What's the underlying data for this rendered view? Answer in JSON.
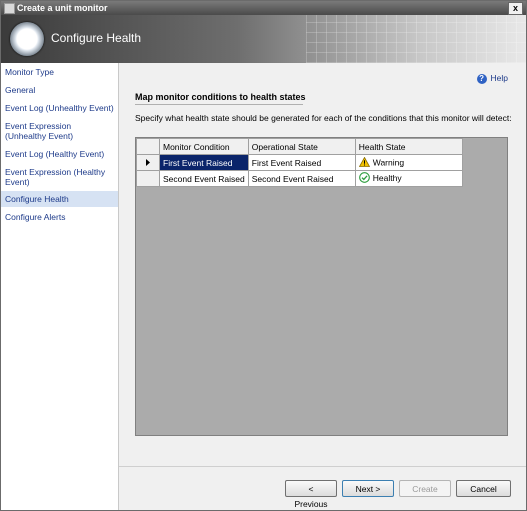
{
  "window": {
    "title": "Create a unit monitor",
    "close_label": "x"
  },
  "banner": {
    "title": "Configure Health"
  },
  "nav": {
    "items": [
      {
        "label": "Monitor Type"
      },
      {
        "label": "General"
      },
      {
        "label": "Event Log (Unhealthy Event)"
      },
      {
        "label": "Event Expression (Unhealthy Event)"
      },
      {
        "label": "Event Log (Healthy Event)"
      },
      {
        "label": "Event Expression (Healthy Event)"
      },
      {
        "label": "Configure Health",
        "selected": true
      },
      {
        "label": "Configure Alerts"
      }
    ]
  },
  "content": {
    "help_label": "Help",
    "section_title": "Map monitor conditions to health states",
    "instructions": "Specify what health state should be generated for each of the conditions that this monitor will detect:",
    "grid": {
      "columns": [
        "Monitor Condition",
        "Operational State",
        "Health State"
      ],
      "rows": [
        {
          "condition": "First Event Raised",
          "operational_state": "First Event Raised",
          "health_state": "Warning",
          "health_icon": "warning-icon",
          "current": true
        },
        {
          "condition": "Second Event Raised",
          "operational_state": "Second Event Raised",
          "health_state": "Healthy",
          "health_icon": "healthy-check-icon",
          "current": false
        }
      ]
    }
  },
  "buttons": {
    "previous": "< Previous",
    "next": "Next >",
    "create": "Create",
    "cancel": "Cancel"
  },
  "colors": {
    "selection": "#0a246a",
    "nav_link": "#1e3b8a",
    "warning": "#f2c200",
    "healthy": "#2e9e3e"
  }
}
